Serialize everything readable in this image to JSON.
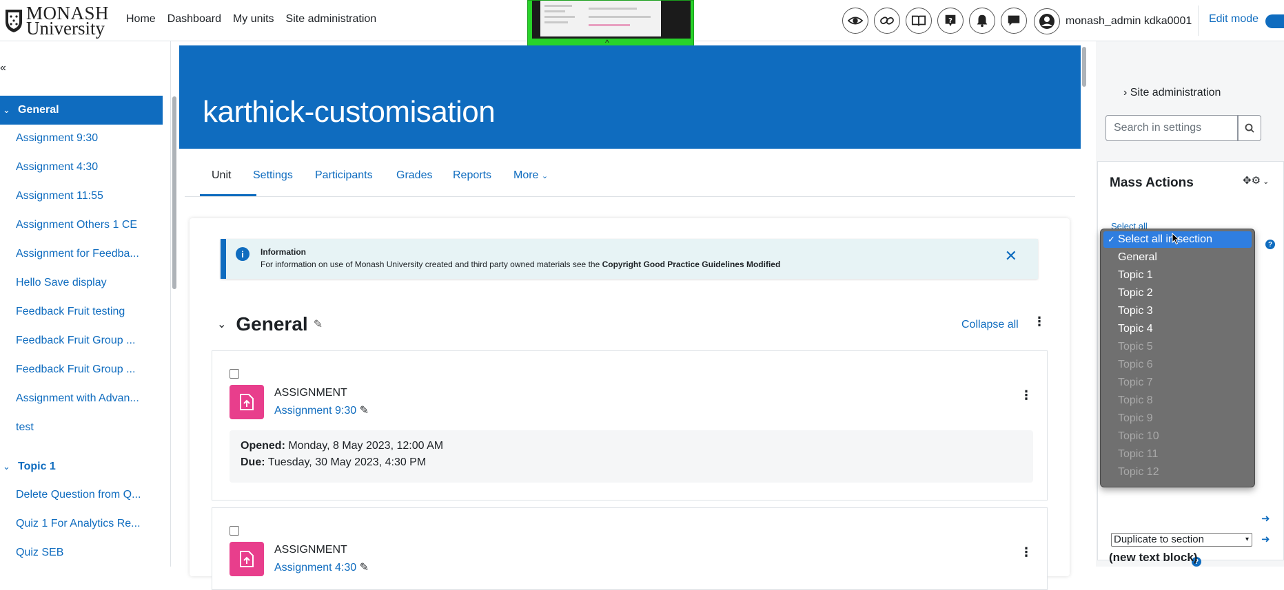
{
  "brand": {
    "line1": "MONASH",
    "line2": "University"
  },
  "primary_nav": [
    "Home",
    "Dashboard",
    "My units",
    "Site administration"
  ],
  "toolbar_icons": [
    "eye-icon",
    "link-icon",
    "book-icon",
    "help-icon",
    "bell-icon",
    "chat-icon"
  ],
  "user": {
    "name": "monash_admin kdka0001"
  },
  "edit_mode": {
    "label": "Edit mode",
    "on": true
  },
  "course_index": {
    "sections": [
      {
        "label": "General",
        "active": true,
        "items": [
          "Assignment 9:30",
          "Assignment 4:30",
          "Assignment 11:55",
          "Assignment Others 1 CE",
          "Assignment for Feedba...",
          "Hello Save display",
          "Feedback Fruit testing",
          "Feedback Fruit Group ...",
          "Feedback Fruit Group ...",
          "Assignment with Advan...",
          "test"
        ]
      },
      {
        "label": "Topic 1",
        "active": false,
        "items": [
          "Delete Question from Q...",
          "Quiz 1 For Analytics Re...",
          "Quiz SEB"
        ]
      }
    ]
  },
  "course": {
    "title": "karthick-customisation"
  },
  "secondary_nav": {
    "tabs": [
      "Unit",
      "Settings",
      "Participants",
      "Grades",
      "Reports",
      "More"
    ],
    "active": "Unit"
  },
  "notice": {
    "title": "Information",
    "body": "For information on use of Monash University created and third party owned materials see the",
    "link": "Copyright Good Practice Guidelines Modified"
  },
  "section": {
    "title": "General",
    "collapse_label": "Collapse all"
  },
  "activities": [
    {
      "type": "ASSIGNMENT",
      "name": "Assignment 9:30",
      "opened_label": "Opened:",
      "opened": "Monday, 8 May 2023, 12:00 AM",
      "due_label": "Due:",
      "due": "Tuesday, 30 May 2023, 4:30 PM"
    },
    {
      "type": "ASSIGNMENT",
      "name": "Assignment 4:30"
    }
  ],
  "right_drawer": {
    "crumb": "Site administration",
    "search_placeholder": "Search in settings",
    "block_title": "Mass Actions",
    "select_all": "Select all",
    "duplicate_select": "Duplicate to section",
    "next_block_title": "(new text block)"
  },
  "dropdown": {
    "options": [
      {
        "label": "Select all in section",
        "selected": true,
        "disabled": false
      },
      {
        "label": "General",
        "selected": false,
        "disabled": false
      },
      {
        "label": "Topic 1",
        "selected": false,
        "disabled": false
      },
      {
        "label": "Topic 2",
        "selected": false,
        "disabled": false
      },
      {
        "label": "Topic 3",
        "selected": false,
        "disabled": false
      },
      {
        "label": "Topic 4",
        "selected": false,
        "disabled": false
      },
      {
        "label": "Topic 5",
        "selected": false,
        "disabled": true
      },
      {
        "label": "Topic 6",
        "selected": false,
        "disabled": true
      },
      {
        "label": "Topic 7",
        "selected": false,
        "disabled": true
      },
      {
        "label": "Topic 8",
        "selected": false,
        "disabled": true
      },
      {
        "label": "Topic 9",
        "selected": false,
        "disabled": true
      },
      {
        "label": "Topic 10",
        "selected": false,
        "disabled": true
      },
      {
        "label": "Topic 11",
        "selected": false,
        "disabled": true
      },
      {
        "label": "Topic 12",
        "selected": false,
        "disabled": true
      }
    ]
  },
  "colors": {
    "brand_blue": "#0f6cbf",
    "assignment_pink": "#e83e8c",
    "info_bg": "#e7f3f5"
  }
}
